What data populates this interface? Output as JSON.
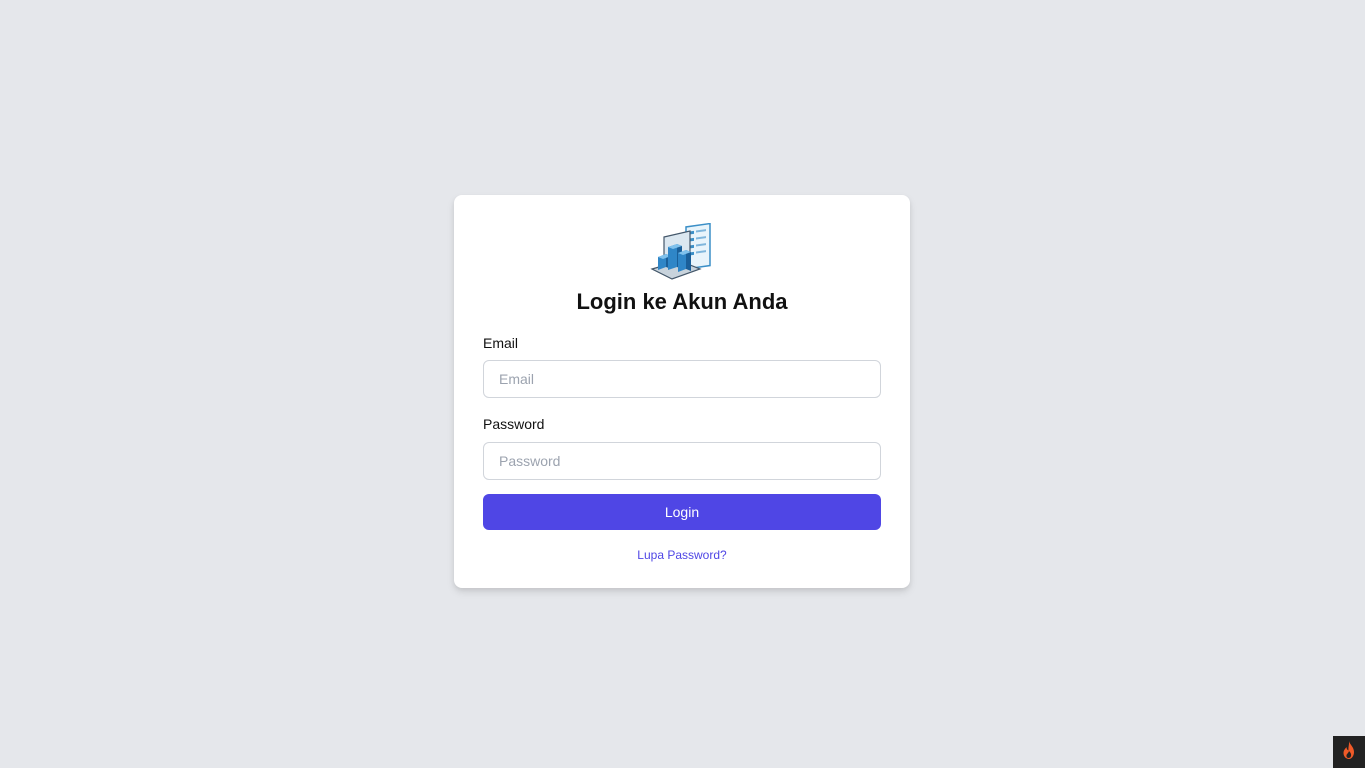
{
  "app": {
    "logo_icon": "server-documents-icon"
  },
  "login_card": {
    "title": "Login ke Akun Anda",
    "email_label": "Email",
    "email_placeholder": "Email",
    "email_value": "",
    "password_label": "Password",
    "password_placeholder": "Password",
    "password_value": "",
    "submit_label": "Login",
    "forgot_link": "Lupa Password?"
  },
  "colors": {
    "background": "#e5e7eb",
    "card": "#ffffff",
    "accent": "#4f46e5",
    "badge_background": "#222222",
    "flame": "#f05a28"
  },
  "debug_badge": {
    "icon": "flame-icon"
  }
}
